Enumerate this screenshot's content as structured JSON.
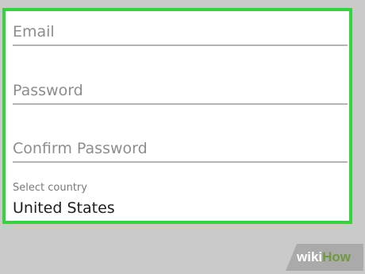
{
  "form": {
    "email": {
      "placeholder": "Email",
      "value": ""
    },
    "password": {
      "placeholder": "Password",
      "value": ""
    },
    "confirm_password": {
      "placeholder": "Confirm Password",
      "value": ""
    },
    "country": {
      "label": "Select country",
      "selected": "United States"
    }
  },
  "watermark": {
    "part1": "wiki",
    "part2": "How"
  },
  "colors": {
    "background": "#c9cac9",
    "card_border": "#35d43e",
    "underline": "#b4b4b4",
    "placeholder": "#8d8d8d",
    "watermark_green": "#6e9a42"
  }
}
